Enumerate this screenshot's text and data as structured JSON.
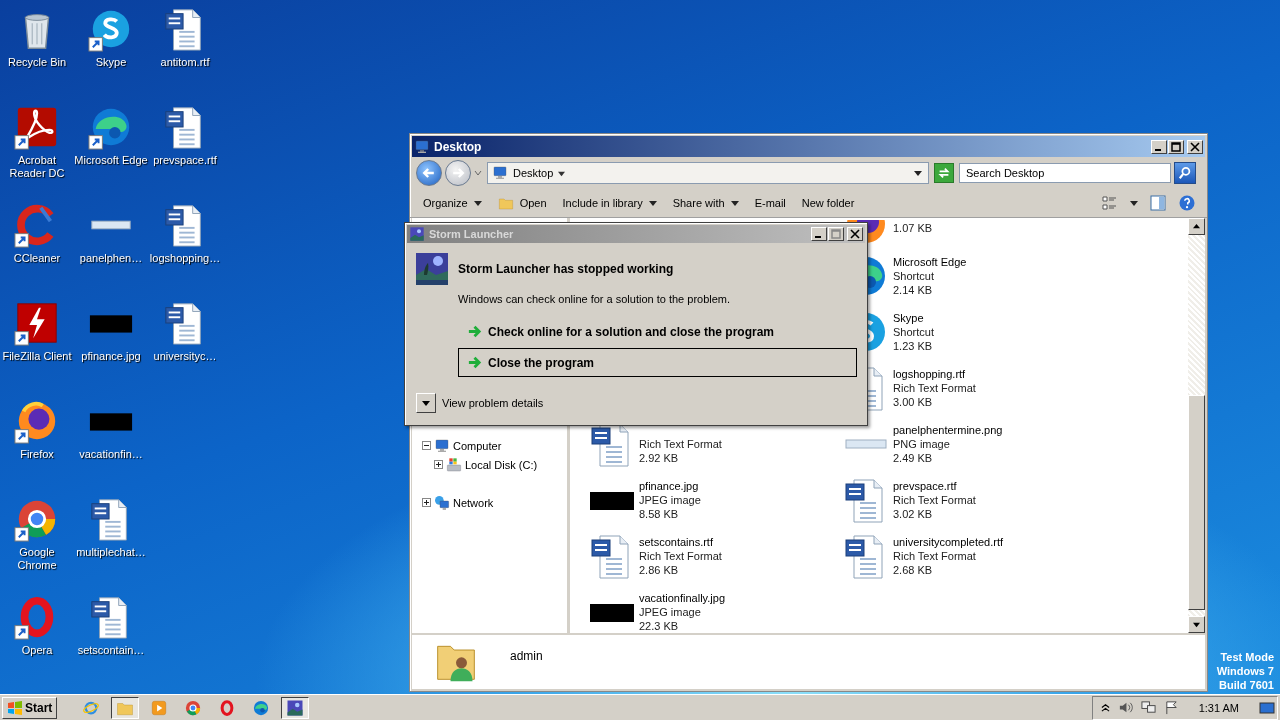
{
  "desktop": {
    "icons": [
      {
        "label": "Recycle Bin",
        "kind": "recycle",
        "shortcut": false
      },
      {
        "label": "Acrobat Reader DC",
        "kind": "acrobat",
        "shortcut": true
      },
      {
        "label": "CCleaner",
        "kind": "ccleaner",
        "shortcut": true
      },
      {
        "label": "FileZilla Client",
        "kind": "filezilla",
        "shortcut": true
      },
      {
        "label": "Firefox",
        "kind": "firefox",
        "shortcut": true
      },
      {
        "label": "Google Chrome",
        "kind": "chrome",
        "shortcut": true
      },
      {
        "label": "Opera",
        "kind": "opera",
        "shortcut": true
      },
      {
        "label": "Skype",
        "kind": "skype",
        "shortcut": true
      },
      {
        "label": "Microsoft Edge",
        "kind": "edge",
        "shortcut": true
      },
      {
        "label": "panelphen…",
        "kind": "blank-image",
        "shortcut": false
      },
      {
        "label": "pfinance.jpg",
        "kind": "black-image",
        "shortcut": false
      },
      {
        "label": "vacationfin…",
        "kind": "black-image",
        "shortcut": false
      },
      {
        "label": "multiplechat…",
        "kind": "word",
        "shortcut": false
      },
      {
        "label": "setscontain…",
        "kind": "word",
        "shortcut": false
      },
      {
        "label": "antitom.rtf",
        "kind": "word",
        "shortcut": false
      },
      {
        "label": "prevspace.rtf",
        "kind": "word",
        "shortcut": false
      },
      {
        "label": "logshopping…",
        "kind": "word",
        "shortcut": false
      },
      {
        "label": "universityc…",
        "kind": "word",
        "shortcut": false
      }
    ],
    "test_mode": [
      "Test Mode",
      "Windows 7",
      "Build 7601"
    ]
  },
  "explorer": {
    "title": "Desktop",
    "address": "Desktop",
    "search": {
      "placeholder": "Search Desktop"
    },
    "toolbar": [
      {
        "label": "Organize",
        "dropdown": true,
        "icon": false
      },
      {
        "label": "Open",
        "dropdown": false,
        "icon": true
      },
      {
        "label": "Include in library",
        "dropdown": true,
        "icon": false
      },
      {
        "label": "Share with",
        "dropdown": true,
        "icon": false
      },
      {
        "label": "E-mail",
        "dropdown": false,
        "icon": false
      },
      {
        "label": "New folder",
        "dropdown": false,
        "icon": false
      }
    ],
    "nav": [
      {
        "label": "Computer",
        "kind": "computer",
        "expanded": true,
        "children": [
          {
            "label": "Local Disk (C:)",
            "kind": "disk",
            "expanded": false
          }
        ]
      },
      {
        "label": "Network",
        "kind": "network",
        "expanded": false
      }
    ],
    "files": {
      "left": [
        {
          "kind": "word",
          "type": "Rich Text Format",
          "size": "2.92 KB"
        },
        {
          "name": "pfinance.jpg",
          "kind": "black-image",
          "type": "JPEG image",
          "size": "8.58 KB"
        },
        {
          "name": "setscontains.rtf",
          "kind": "word",
          "type": "Rich Text Format",
          "size": "2.86 KB"
        },
        {
          "name": "vacationfinally.jpg",
          "kind": "black-image",
          "type": "JPEG image",
          "size": "22.3 KB"
        }
      ],
      "right": [
        {
          "kind": "firefox",
          "size": "1.07 KB"
        },
        {
          "name": "Microsoft Edge",
          "kind": "edge",
          "type": "Shortcut",
          "size": "2.14 KB"
        },
        {
          "name": "Skype",
          "kind": "skype",
          "type": "Shortcut",
          "size": "1.23 KB"
        },
        {
          "name": "logshopping.rtf",
          "kind": "word",
          "type": "Rich Text Format",
          "size": "3.00 KB"
        },
        {
          "name": "panelphentermine.png",
          "kind": "blank-image",
          "type": "PNG image",
          "size": "2.49 KB"
        },
        {
          "name": "prevspace.rtf",
          "kind": "word",
          "type": "Rich Text Format",
          "size": "3.02 KB"
        },
        {
          "name": "universitycompleted.rtf",
          "kind": "word",
          "type": "Rich Text Format",
          "size": "2.68 KB"
        }
      ]
    },
    "details": {
      "name": "admin"
    }
  },
  "dialog": {
    "title": "Storm Launcher",
    "heading": "Storm Launcher has stopped working",
    "text": "Windows can check online for a solution to the problem.",
    "options": [
      {
        "label": "Check online for a solution and close the program",
        "selected": false
      },
      {
        "label": "Close the program",
        "selected": true
      }
    ],
    "details_toggle": "View problem details"
  },
  "taskbar": {
    "start": "Start",
    "apps": [
      {
        "kind": "ie",
        "selected": false
      },
      {
        "kind": "folder",
        "selected": true
      },
      {
        "kind": "media",
        "selected": false
      },
      {
        "kind": "chrome",
        "selected": false
      },
      {
        "kind": "opera",
        "selected": false
      },
      {
        "kind": "edge",
        "selected": false
      },
      {
        "kind": "storm",
        "selected": true
      }
    ],
    "clock": "1:31 AM"
  }
}
